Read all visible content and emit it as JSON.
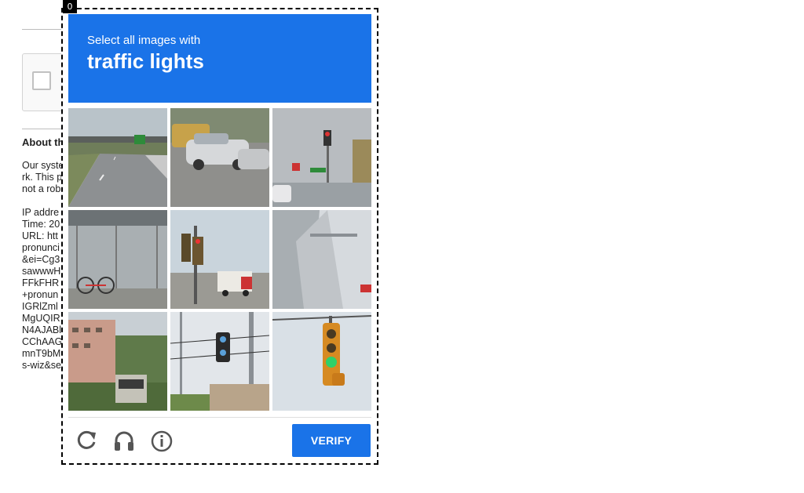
{
  "frame_badge": "0",
  "background_page": {
    "heading": "About th",
    "lines": [
      "Our syste",
      "rk. This p",
      "not a rob",
      "",
      "IP addre",
      "Time: 20",
      "URL: htt",
      "pronunci",
      "&ei=Cg3",
      "sawwwH",
      "FFkFHR",
      "+pronun",
      "IGRlZml",
      "MgUQIR",
      "N4AJABl",
      "CChAAG",
      "mnT9bM",
      "s-wiz&se"
    ]
  },
  "challenge": {
    "instruction": "Select all images with",
    "target": "traffic lights",
    "tiles": [
      {
        "name": "tile-highway",
        "label": "highway with green road sign"
      },
      {
        "name": "tile-parked-cars",
        "label": "parked cars on street"
      },
      {
        "name": "tile-building-traffic-light",
        "label": "gray building with traffic light"
      },
      {
        "name": "tile-bike-shelter",
        "label": "bicycles in glass shelter"
      },
      {
        "name": "tile-traffic-light-truck",
        "label": "traffic light and truck"
      },
      {
        "name": "tile-turnstile",
        "label": "metal turnstile"
      },
      {
        "name": "tile-bus-apartments",
        "label": "bus near apartments"
      },
      {
        "name": "tile-pedestrian-signal",
        "label": "pedestrian signal on pole"
      },
      {
        "name": "tile-green-traffic-light",
        "label": "hanging green traffic light"
      }
    ],
    "buttons": {
      "reload": "reload-icon",
      "audio": "headphones-icon",
      "info": "info-icon",
      "verify_label": "VERIFY"
    },
    "colors": {
      "accent": "#1a73e8",
      "icon_gray": "#555555"
    }
  }
}
